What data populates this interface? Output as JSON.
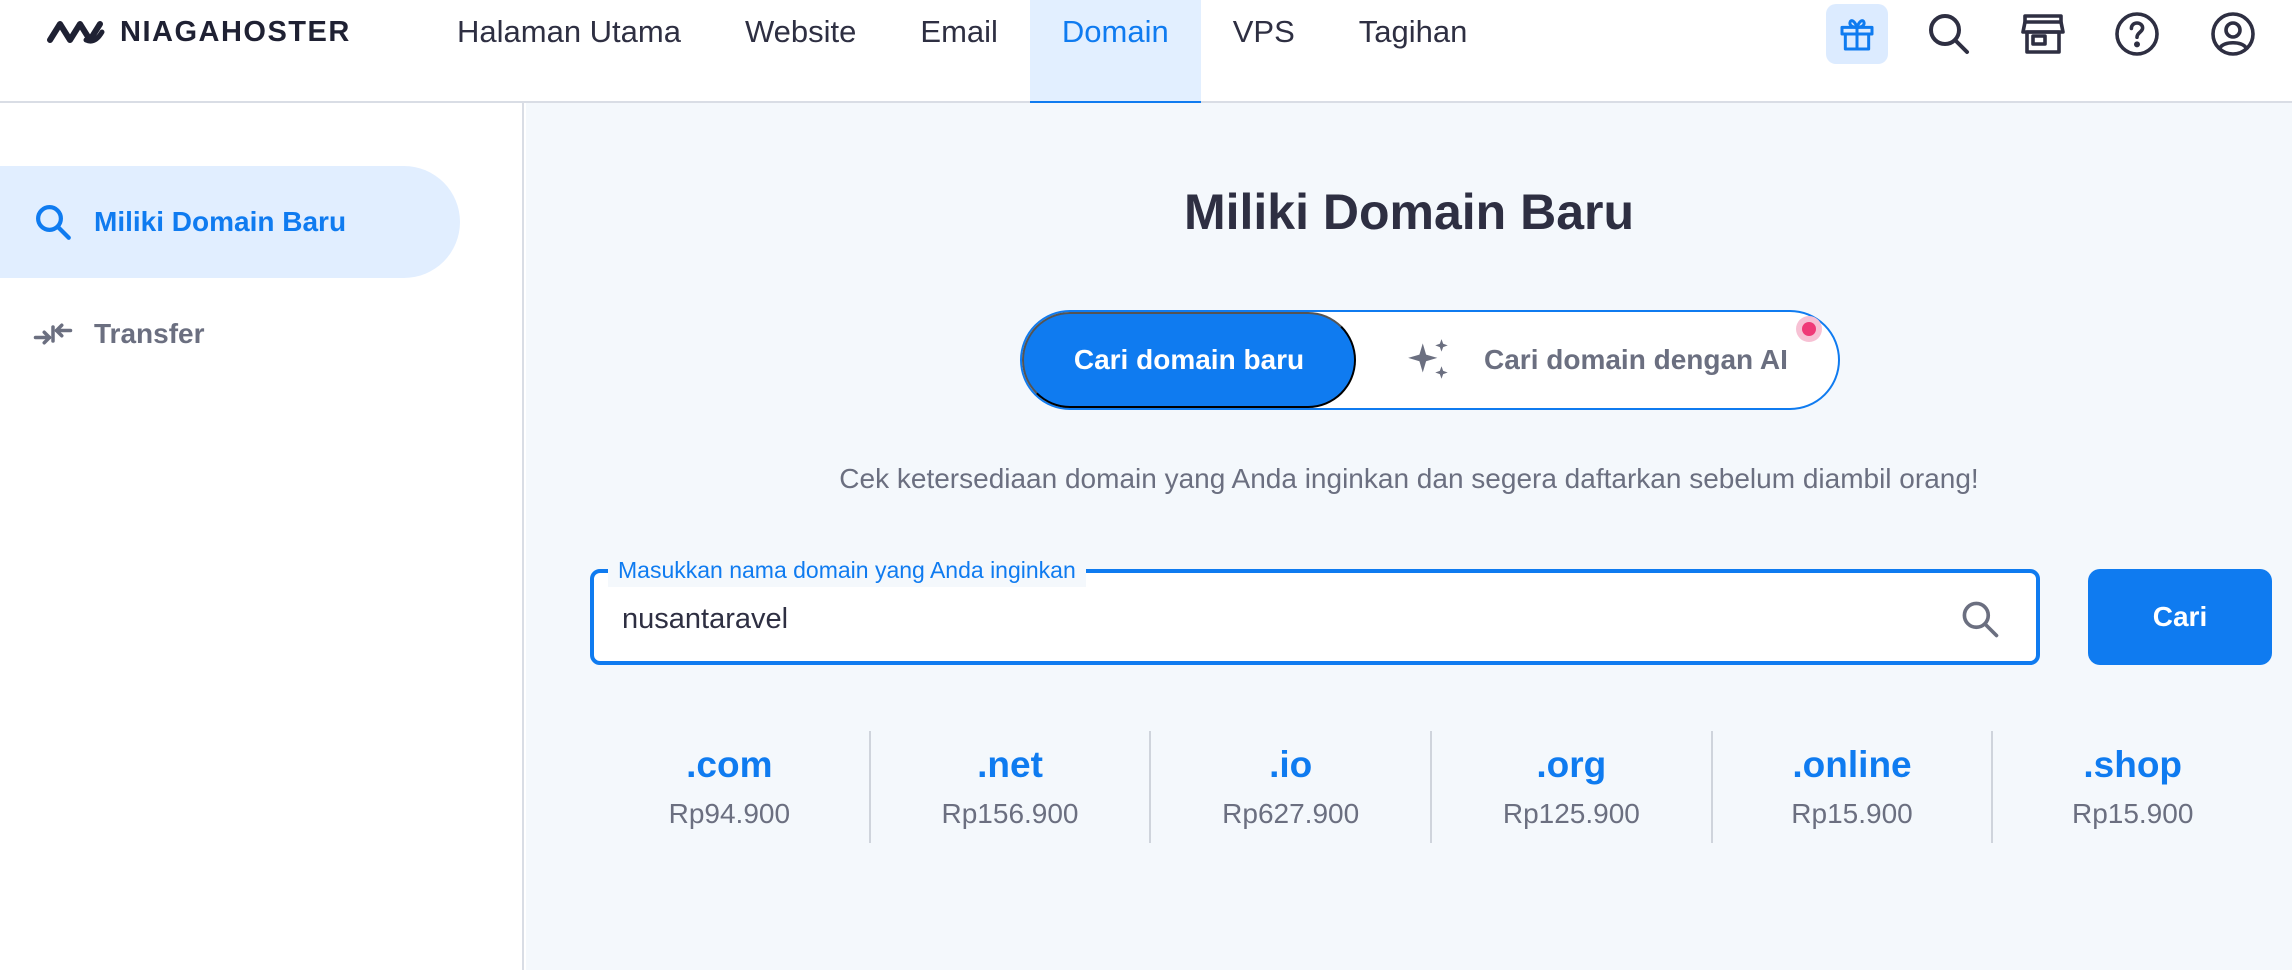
{
  "brand": {
    "name": "NIAGAHOSTER"
  },
  "nav": {
    "items": [
      {
        "label": "Halaman Utama",
        "active": false
      },
      {
        "label": "Website",
        "active": false
      },
      {
        "label": "Email",
        "active": false
      },
      {
        "label": "Domain",
        "active": true
      },
      {
        "label": "VPS",
        "active": false
      },
      {
        "label": "Tagihan",
        "active": false
      }
    ],
    "icons": [
      "gift-icon",
      "search-icon",
      "store-icon",
      "help-icon",
      "user-account-icon"
    ]
  },
  "sidebar": {
    "items": [
      {
        "label": "Miliki Domain Baru",
        "icon": "search-icon",
        "active": true
      },
      {
        "label": "Transfer",
        "icon": "transfer-arrows-icon",
        "active": false
      }
    ]
  },
  "main": {
    "title": "Miliki Domain Baru",
    "toggle": {
      "option_new": "Cari domain baru",
      "option_ai": "Cari domain dengan AI"
    },
    "subtitle": "Cek ketersediaan domain yang Anda inginkan dan segera daftarkan sebelum diambil orang!",
    "search": {
      "label": "Masukkan nama domain yang Anda inginkan",
      "value": "nusantaravel",
      "button": "Cari"
    },
    "tlds": [
      {
        "name": ".com",
        "price": "Rp94.900"
      },
      {
        "name": ".net",
        "price": "Rp156.900"
      },
      {
        "name": ".io",
        "price": "Rp627.900"
      },
      {
        "name": ".org",
        "price": "Rp125.900"
      },
      {
        "name": ".online",
        "price": "Rp15.900"
      },
      {
        "name": ".shop",
        "price": "Rp15.900"
      }
    ]
  },
  "colors": {
    "accent": "#0f7bf0",
    "accent_light": "#e1eeff",
    "text_dark": "#2e2f42",
    "text_muted": "#6b6f80",
    "main_bg": "#f4f8fc",
    "notification": "#ef3a77"
  }
}
